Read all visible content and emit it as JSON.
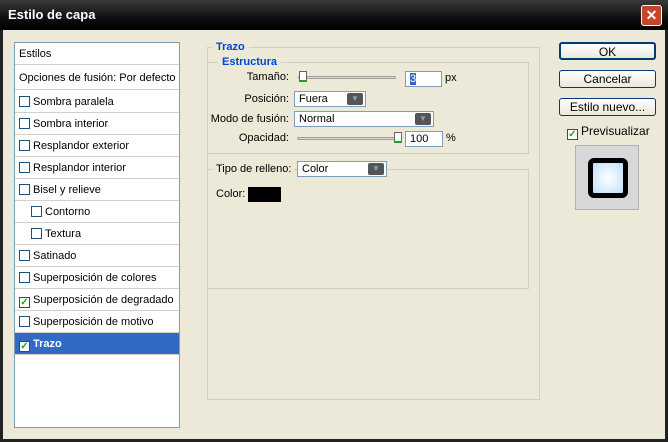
{
  "window": {
    "title": "Estilo de capa",
    "close": "✕"
  },
  "styles_list": {
    "header": "Estilos",
    "blend_options": "Opciones de fusión: Por defecto",
    "items": [
      {
        "label": "Sombra paralela",
        "checked": false
      },
      {
        "label": "Sombra interior",
        "checked": false
      },
      {
        "label": "Resplandor exterior",
        "checked": false
      },
      {
        "label": "Resplandor interior",
        "checked": false
      },
      {
        "label": "Bisel y relieve",
        "checked": false
      },
      {
        "label": "Contorno",
        "checked": false
      },
      {
        "label": "Textura",
        "checked": false
      },
      {
        "label": "Satinado",
        "checked": false
      },
      {
        "label": "Superposición de colores",
        "checked": false
      },
      {
        "label": "Superposición de degradado",
        "checked": true
      },
      {
        "label": "Superposición de motivo",
        "checked": false
      },
      {
        "label": "Trazo",
        "checked": true
      }
    ]
  },
  "stroke": {
    "title": "Trazo",
    "structure": "Estructura",
    "size_label": "Tamaño:",
    "size_value": "3",
    "size_unit": "px",
    "size_slider": 0.01,
    "position_label": "Posición:",
    "position_value": "Fuera",
    "blend_label": "Modo de fusión:",
    "blend_value": "Normal",
    "opacity_label": "Opacidad:",
    "opacity_value": "100",
    "opacity_unit": "%",
    "opacity_slider": 1.0,
    "fill_label": "Tipo de relleno:",
    "fill_value": "Color",
    "color_label": "Color:",
    "color": "#000000"
  },
  "buttons": {
    "ok": "OK",
    "cancel": "Cancelar",
    "new_style": "Estilo nuevo...",
    "preview": "Previsualizar"
  }
}
